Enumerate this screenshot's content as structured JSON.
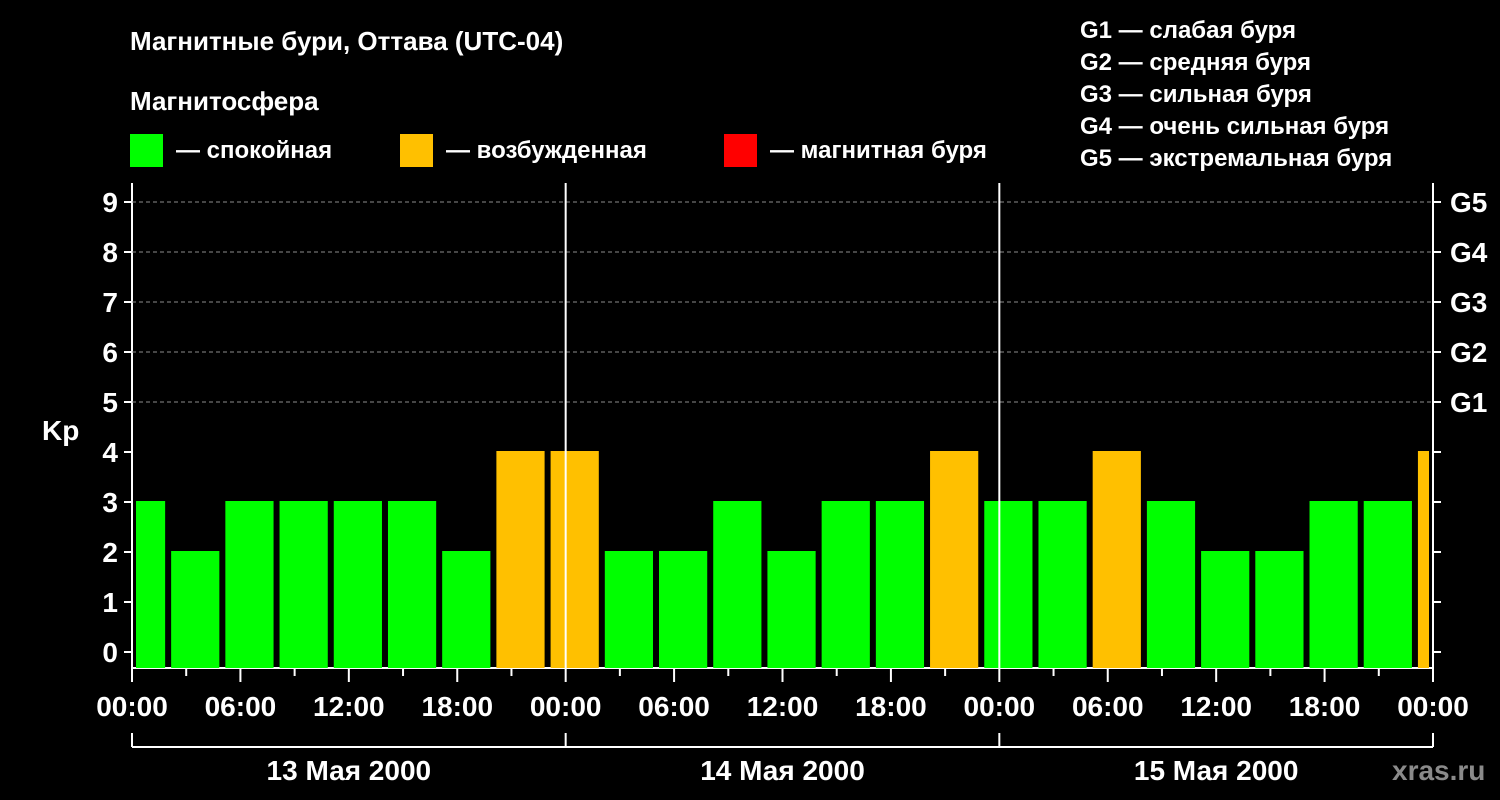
{
  "chart_data": {
    "type": "bar",
    "title": "Магнитные бури, Оттава (UTC-04)",
    "legend_title": "Магнитосфера",
    "legend": [
      {
        "label": "— спокойная",
        "color": "#00ff00"
      },
      {
        "label": "— возбужденная",
        "color": "#ffc000"
      },
      {
        "label": "— магнитная буря",
        "color": "#ff0000"
      }
    ],
    "storm_scale": [
      "G1 — слабая буря",
      "G2 — средняя буря",
      "G3 — сильная буря",
      "G4 — очень сильная буря",
      "G5 — экстремальная буря"
    ],
    "ylabel": "Kp",
    "ylim": [
      0,
      9
    ],
    "yticks": [
      "0",
      "1",
      "2",
      "3",
      "4",
      "5",
      "6",
      "7",
      "8",
      "9"
    ],
    "right_ticks": [
      {
        "kp": 5,
        "label": "G1"
      },
      {
        "kp": 6,
        "label": "G2"
      },
      {
        "kp": 7,
        "label": "G3"
      },
      {
        "kp": 8,
        "label": "G4"
      },
      {
        "kp": 9,
        "label": "G5"
      }
    ],
    "xticks": [
      "00:00",
      "06:00",
      "12:00",
      "18:00",
      "00:00",
      "06:00",
      "12:00",
      "18:00",
      "00:00",
      "06:00",
      "12:00",
      "18:00",
      "00:00"
    ],
    "days": [
      "13 Мая 2000",
      "14 Мая 2000",
      "15 Мая 2000"
    ],
    "x_hours_range": [
      0,
      72
    ],
    "grid": "dashed at Kp 5-9",
    "bars": [
      {
        "start_h": 0,
        "end_h": 2,
        "value": 3,
        "level": "quiet"
      },
      {
        "start_h": 2,
        "end_h": 5,
        "value": 2,
        "level": "quiet"
      },
      {
        "start_h": 5,
        "end_h": 8,
        "value": 3,
        "level": "quiet"
      },
      {
        "start_h": 8,
        "end_h": 11,
        "value": 3,
        "level": "quiet"
      },
      {
        "start_h": 11,
        "end_h": 14,
        "value": 3,
        "level": "quiet"
      },
      {
        "start_h": 14,
        "end_h": 17,
        "value": 3,
        "level": "quiet"
      },
      {
        "start_h": 17,
        "end_h": 20,
        "value": 2,
        "level": "quiet"
      },
      {
        "start_h": 20,
        "end_h": 23,
        "value": 4,
        "level": "active"
      },
      {
        "start_h": 23,
        "end_h": 26,
        "value": 4,
        "level": "active"
      },
      {
        "start_h": 26,
        "end_h": 29,
        "value": 2,
        "level": "quiet"
      },
      {
        "start_h": 29,
        "end_h": 32,
        "value": 2,
        "level": "quiet"
      },
      {
        "start_h": 32,
        "end_h": 35,
        "value": 3,
        "level": "quiet"
      },
      {
        "start_h": 35,
        "end_h": 38,
        "value": 2,
        "level": "quiet"
      },
      {
        "start_h": 38,
        "end_h": 41,
        "value": 3,
        "level": "quiet"
      },
      {
        "start_h": 41,
        "end_h": 44,
        "value": 3,
        "level": "quiet"
      },
      {
        "start_h": 44,
        "end_h": 47,
        "value": 4,
        "level": "active"
      },
      {
        "start_h": 47,
        "end_h": 50,
        "value": 3,
        "level": "quiet"
      },
      {
        "start_h": 50,
        "end_h": 53,
        "value": 3,
        "level": "quiet"
      },
      {
        "start_h": 53,
        "end_h": 56,
        "value": 4,
        "level": "active"
      },
      {
        "start_h": 56,
        "end_h": 59,
        "value": 3,
        "level": "quiet"
      },
      {
        "start_h": 59,
        "end_h": 62,
        "value": 2,
        "level": "quiet"
      },
      {
        "start_h": 62,
        "end_h": 65,
        "value": 2,
        "level": "quiet"
      },
      {
        "start_h": 65,
        "end_h": 68,
        "value": 3,
        "level": "quiet"
      },
      {
        "start_h": 68,
        "end_h": 71,
        "value": 3,
        "level": "quiet"
      },
      {
        "start_h": 71,
        "end_h": 72,
        "value": 4,
        "level": "active"
      }
    ],
    "level_colors": {
      "quiet": "#00ff00",
      "active": "#ffc000",
      "storm": "#ff0000"
    }
  },
  "watermark": "xras.ru"
}
